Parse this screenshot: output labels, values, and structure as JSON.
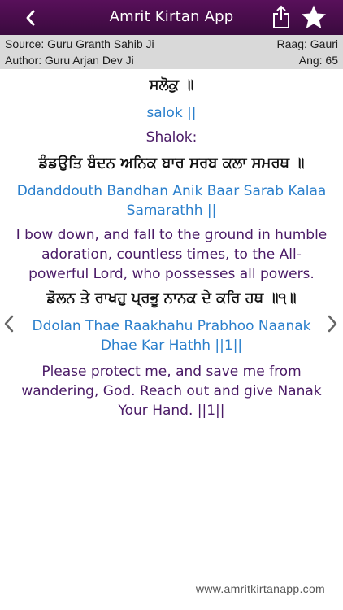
{
  "header": {
    "title": "Amrit Kirtan App",
    "back_icon": "chevron-left-icon",
    "share_icon": "share-icon",
    "favorite_icon": "star-icon",
    "bar_color": "#4b0e50"
  },
  "info": {
    "source": "Source: Guru Granth Sahib Ji",
    "raag": "Raag: Gauri",
    "author": "Author: Guru Arjan Dev Ji",
    "ang": "Ang: 65"
  },
  "verses": [
    {
      "gurmukhi": "ਸਲੋਕੁ ॥",
      "transliteration": "salok ||",
      "translation": "Shalok:"
    },
    {
      "gurmukhi": "ਡੰਡਉਤਿ ਬੰਦਨ ਅਨਿਕ ਬਾਰ ਸਰਬ ਕਲਾ ਸਮਰਥ ॥",
      "transliteration": "Ddanddouth Bandhan Anik Baar Sarab Kalaa Samarathh ||",
      "translation": "I bow down, and fall to the ground in humble adoration, countless times, to the All-powerful Lord, who possesses all powers."
    },
    {
      "gurmukhi": "ਡੋਲਨ ਤੇ ਰਾਖਹੁ ਪ੍ਰਭੂ ਨਾਨਕ ਦੇ ਕਰਿ ਹਥ ॥੧॥",
      "transliteration": "Ddolan Thae Raakhahu Prabhoo Naanak Dhae Kar Hathh ||1||",
      "translation": "Please protect me, and save me from wandering, God. Reach out and give Nanak Your Hand. ||1||"
    }
  ],
  "navigation": {
    "prev_icon": "chevron-left-icon",
    "next_icon": "chevron-right-icon"
  },
  "footer": {
    "url": "www.amritkirtanapp.com"
  },
  "colors": {
    "transliteration": "#2a7fcc",
    "translation": "#4a1a66",
    "gurmukhi": "#111111",
    "info_bar": "#d9d9d9"
  }
}
